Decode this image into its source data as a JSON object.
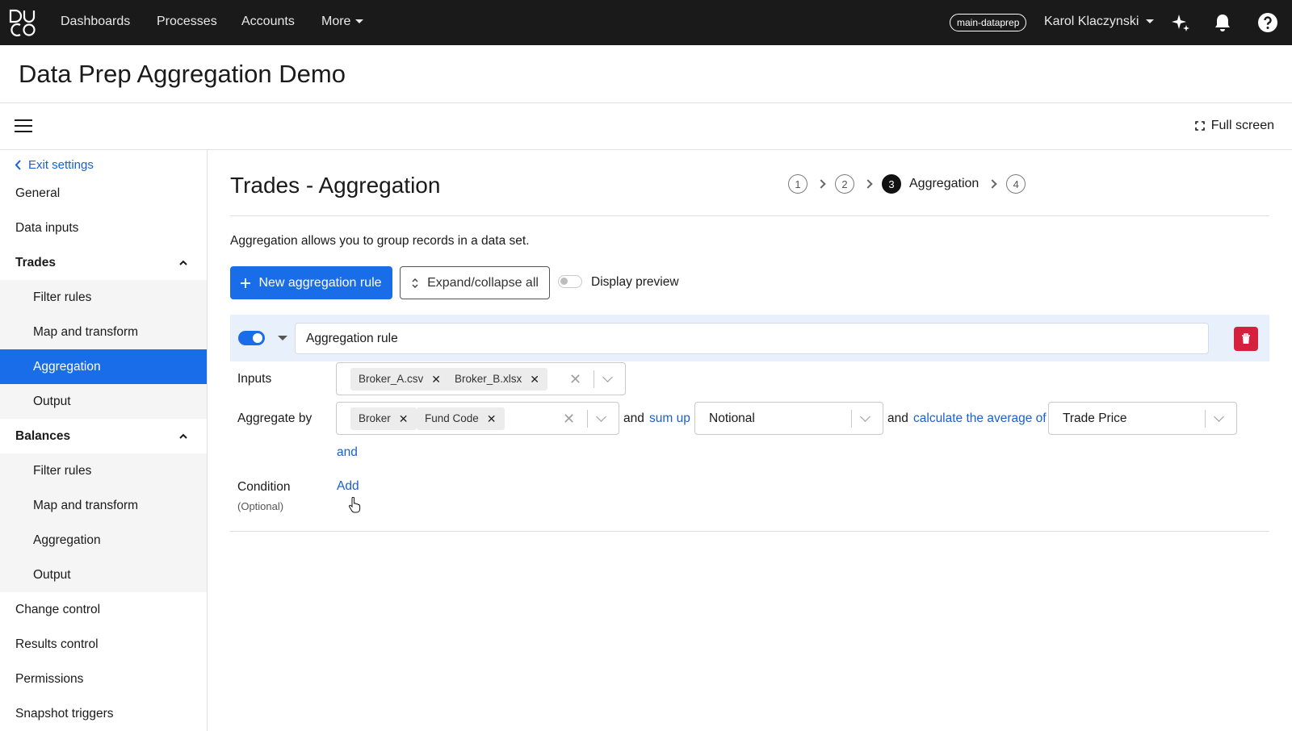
{
  "topbar": {
    "nav": [
      "Dashboards",
      "Processes",
      "Accounts",
      "More"
    ],
    "environment": "main-dataprep",
    "user": "Karol Klaczynski",
    "icons": [
      "duco-logo",
      "sparkle-icon",
      "bell-icon",
      "help-icon"
    ]
  },
  "page": {
    "title": "Data Prep Aggregation Demo"
  },
  "toolbar": {
    "fullscreen_label": "Full screen"
  },
  "sidebar": {
    "exit_label": "Exit settings",
    "items": {
      "general": "General",
      "data_inputs": "Data inputs",
      "trades": "Trades",
      "trades_filter": "Filter rules",
      "trades_map": "Map and transform",
      "trades_aggregation": "Aggregation",
      "trades_output": "Output",
      "balances": "Balances",
      "balances_filter": "Filter rules",
      "balances_map": "Map and transform",
      "balances_aggregation": "Aggregation",
      "balances_output": "Output",
      "change_control": "Change control",
      "results_control": "Results control",
      "permissions": "Permissions",
      "snapshot_triggers": "Snapshot triggers"
    },
    "active": "trades_aggregation"
  },
  "main": {
    "title": "Trades - Aggregation",
    "stepper": {
      "steps": [
        "1",
        "2",
        "3",
        "4"
      ],
      "current": "3",
      "current_label": "Aggregation"
    },
    "description": "Aggregation allows you to group records in a data set.",
    "new_rule_label": "New aggregation rule",
    "expand_label": "Expand/collapse all",
    "preview_label": "Display preview",
    "preview_enabled": false
  },
  "rule": {
    "enabled": true,
    "name": "Aggregation rule",
    "inputs_label": "Inputs",
    "inputs": [
      "Broker_A.csv",
      "Broker_B.xlsx"
    ],
    "aggregate_by_label": "Aggregate by",
    "aggregate_by": [
      "Broker",
      "Fund Code"
    ],
    "and_word": "and",
    "sum_up_label": "sum up",
    "sum_up_value": "Notional",
    "average_label": "calculate the average of",
    "average_value": "Trade Price",
    "and_link": "and",
    "condition_label": "Condition",
    "condition_optional": "(Optional)",
    "condition_add": "Add"
  },
  "colors": {
    "primary": "#1a6de8",
    "danger": "#d4213d",
    "topbar": "#1a1a1a",
    "link": "#1a5fd1"
  }
}
